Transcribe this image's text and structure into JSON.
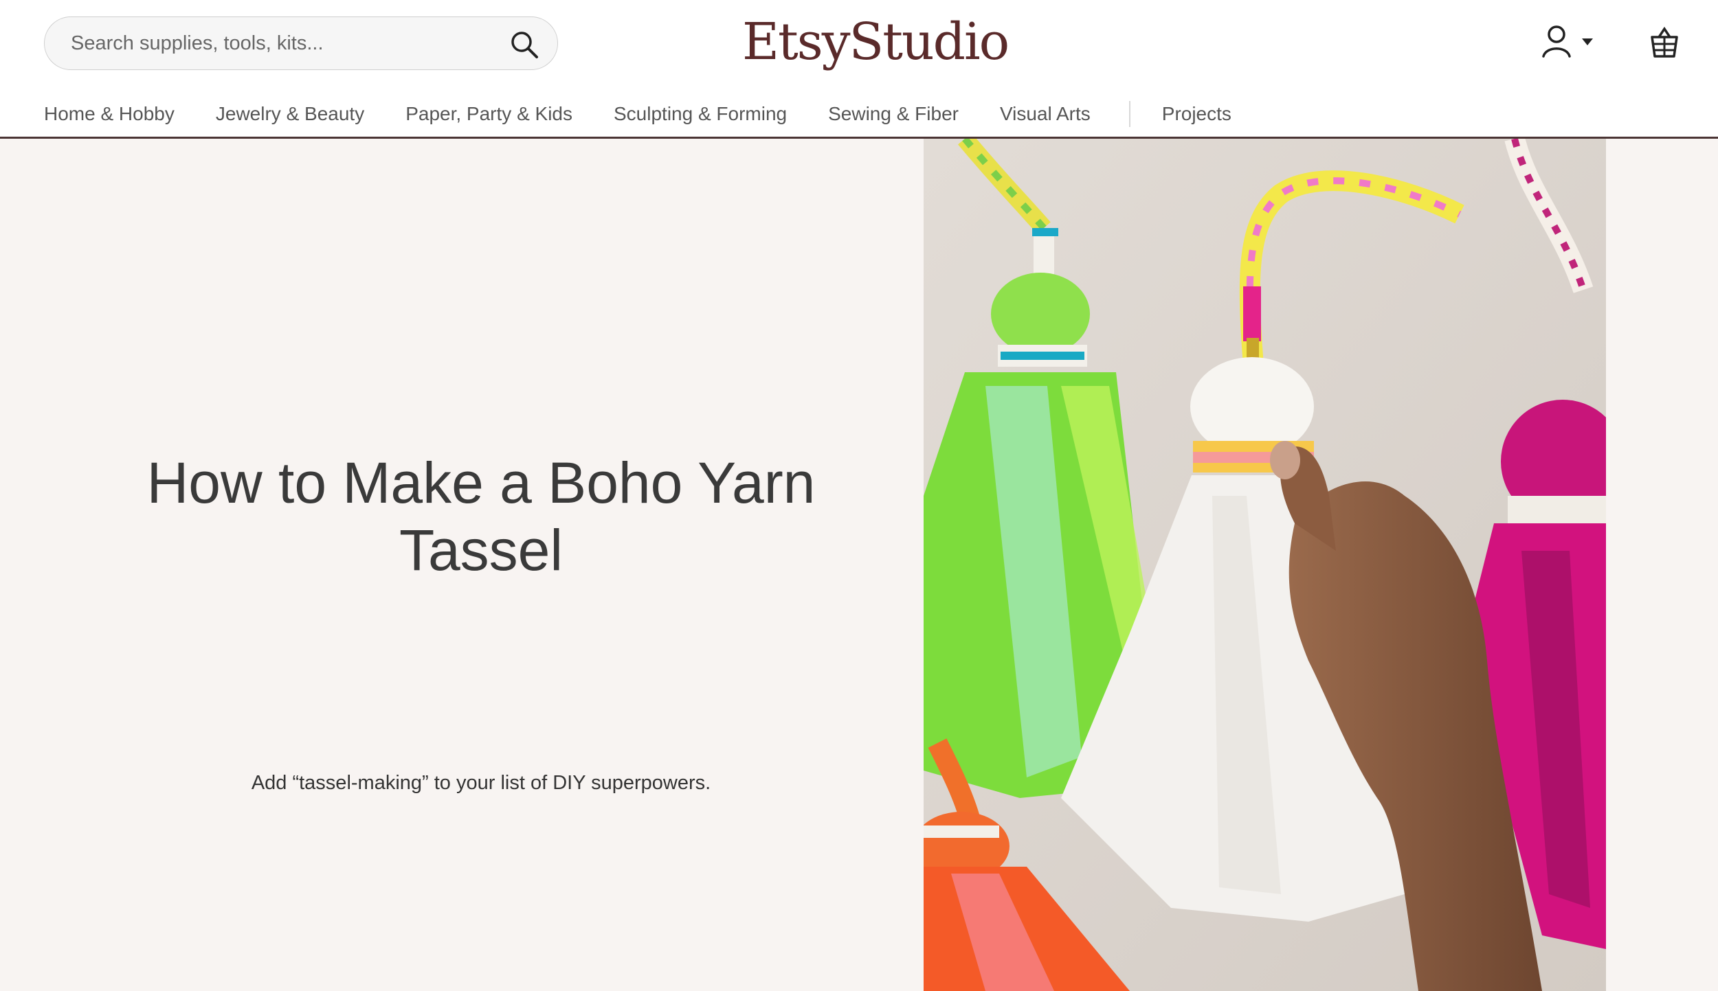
{
  "header": {
    "search": {
      "placeholder": "Search supplies, tools, kits...",
      "value": ""
    },
    "logo": "EtsyStudio",
    "account_icon": "user-icon",
    "caret_icon": "caret-down-icon",
    "cart_icon": "basket-icon"
  },
  "nav": {
    "items": [
      "Home & Hobby",
      "Jewelry & Beauty",
      "Paper, Party & Kids",
      "Sculpting & Forming",
      "Sewing & Fiber",
      "Visual Arts"
    ],
    "projects": "Projects"
  },
  "hero": {
    "title": "How to Make a Boho Yarn Tassel",
    "subtitle": "Add “tassel-making” to your list of DIY superpowers.",
    "background": "#f8f4f2"
  },
  "colors": {
    "brand": "#5a2a2a",
    "rule": "#4a3434"
  }
}
